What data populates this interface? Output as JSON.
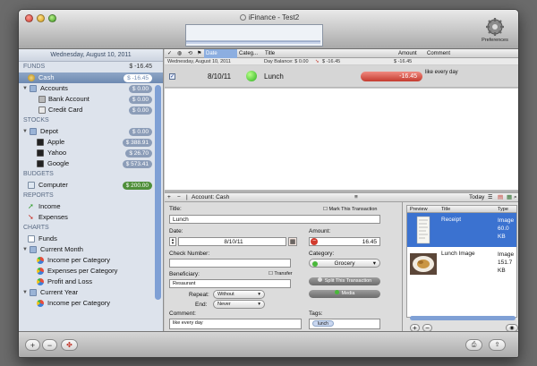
{
  "window": {
    "title": "iFinance - Test2",
    "preferences_label": "Preferences"
  },
  "sidebar": {
    "date": "Wednesday, August 10, 2011",
    "funds": {
      "heading": "FUNDS",
      "total": "$ -16.45",
      "items": [
        {
          "label": "Cash",
          "value": "$ -16.45",
          "selected": true,
          "icon": "coins-icon"
        },
        {
          "label": "Accounts",
          "value": "$ 0.00",
          "icon": "folder-icon"
        },
        {
          "label": "Bank Account",
          "value": "$ 0.00",
          "icon": "bank-icon"
        },
        {
          "label": "Credit Card",
          "value": "$ 0.00",
          "icon": "credit-card-icon"
        }
      ]
    },
    "stocks": {
      "heading": "STOCKS",
      "items": [
        {
          "label": "Depot",
          "value": "$ 0.00",
          "icon": "folder-icon"
        },
        {
          "label": "Apple",
          "value": "$ 388.91",
          "icon": "stock-chart-icon"
        },
        {
          "label": "Yahoo",
          "value": "$ 26.70",
          "icon": "stock-chart-icon"
        },
        {
          "label": "Google",
          "value": "$ 573.41",
          "icon": "stock-chart-icon"
        }
      ]
    },
    "budgets": {
      "heading": "BUDGETS",
      "items": [
        {
          "label": "Computer",
          "value": "$ 200.00",
          "icon": "computer-icon"
        }
      ]
    },
    "reports": {
      "heading": "REPORTS",
      "items": [
        {
          "label": "Income",
          "icon": "income-arrow-icon"
        },
        {
          "label": "Expenses",
          "icon": "expense-arrow-icon"
        }
      ]
    },
    "charts": {
      "heading": "CHARTS",
      "items": [
        {
          "label": "Funds",
          "icon": "chart-icon"
        },
        {
          "label": "Current Month",
          "icon": "folder-icon"
        },
        {
          "label": "Income per Category",
          "icon": "pie-chart-icon"
        },
        {
          "label": "Expenses per Category",
          "icon": "pie-chart-icon"
        },
        {
          "label": "Profit and Loss",
          "icon": "pie-chart-icon"
        },
        {
          "label": "Current Year",
          "icon": "folder-icon"
        },
        {
          "label": "Income per Category",
          "icon": "pie-chart-icon"
        }
      ]
    }
  },
  "transactions": {
    "columns": [
      "Date",
      "Categ...",
      "Title",
      "Amount",
      "Comment"
    ],
    "day_bar": {
      "date": "Wednesday, August 10, 2011",
      "day_balance": "Day Balance: $ 0.00",
      "running": "$ -16.45",
      "running_right": "$ -16.45"
    },
    "rows": [
      {
        "checked": "✓",
        "date": "8/10/11",
        "title": "Lunch",
        "amount": "-16.45",
        "comment": "like every day"
      }
    ]
  },
  "account_bar": {
    "account": "Account: Cash",
    "today": "Today"
  },
  "form": {
    "title_label": "Title:",
    "title_value": "Lunch",
    "mark_label": "Mark This Transaction",
    "date_label": "Date:",
    "date_value": "8/10/11",
    "amount_label": "Amount:",
    "amount_value": "16.45",
    "check_label": "Check Number:",
    "check_value": "",
    "category_label": "Category:",
    "category_value": "Grocery",
    "beneficiary_label": "Beneficiary:",
    "beneficiary_value": "Resaurant",
    "transfer_label": "Transfer",
    "split_label": "Split This Transaction",
    "repeat_label": "Repeat:",
    "repeat_value": "Without",
    "end_label": "End:",
    "end_value": "Never",
    "media_label": "Media",
    "comment_label": "Comment:",
    "comment_value": "like every day",
    "tags_label": "Tags:",
    "tags_value": "lunch"
  },
  "attachments": {
    "columns": [
      "Preview",
      "Title",
      "Type"
    ],
    "items": [
      {
        "title": "Receipt",
        "type": "Image",
        "size": "60.0 KB",
        "selected": true
      },
      {
        "title": "Lunch Image",
        "type": "Image",
        "size": "151.7 KB",
        "selected": false
      }
    ]
  },
  "colors": {
    "accent": "#3b72d0",
    "negative_amount": "#c43b2f",
    "selection": "#6d89b1"
  }
}
